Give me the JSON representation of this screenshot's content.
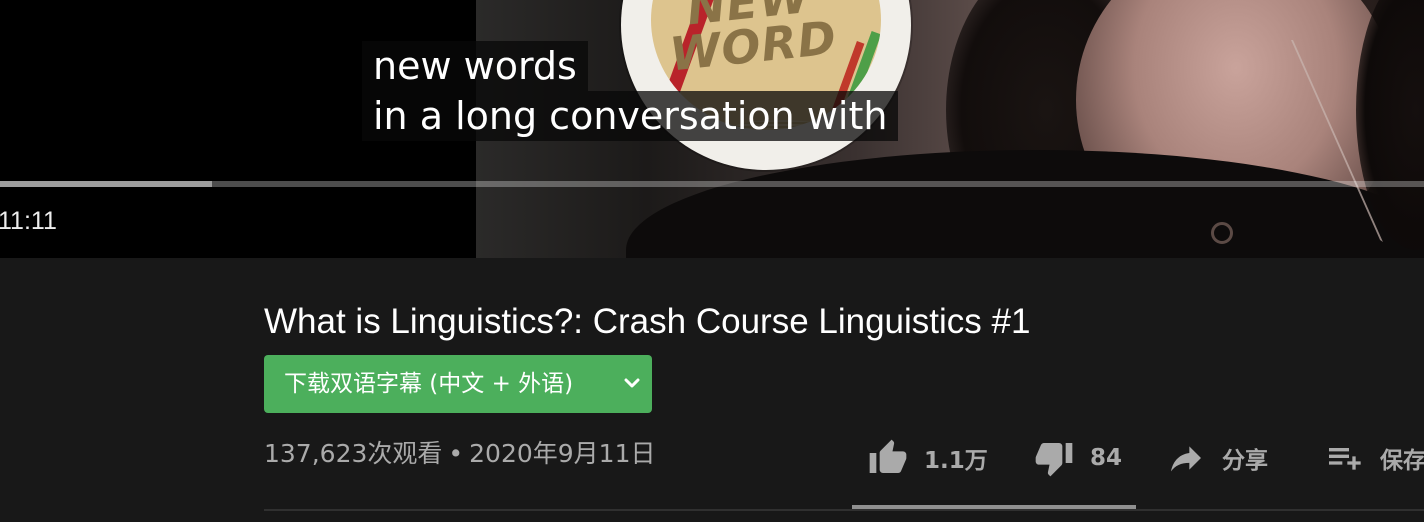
{
  "player": {
    "captions": [
      "new words",
      "in a long conversation with"
    ],
    "sticker_text": [
      "NEW",
      "WORD"
    ],
    "current_time": "11:11",
    "progress": 0.149
  },
  "video": {
    "title": "What is Linguistics?: Crash Course Linguistics #1",
    "subtitle_download_label": "下载双语字幕 (中文 + 外语)",
    "views": "137,623次观看",
    "separator": "•",
    "date": "2020年9月11日"
  },
  "actions": {
    "like_count": "1.1万",
    "dislike_count": "84",
    "share_label": "分享",
    "save_label": "保存"
  },
  "colors": {
    "background": "#181818",
    "download_button": "#4caf5c",
    "secondary_text": "#aaaaaa"
  },
  "icons": [
    "thumbs-up-icon",
    "thumbs-down-icon",
    "share-arrow-icon",
    "playlist-add-icon",
    "chevron-down-icon"
  ]
}
